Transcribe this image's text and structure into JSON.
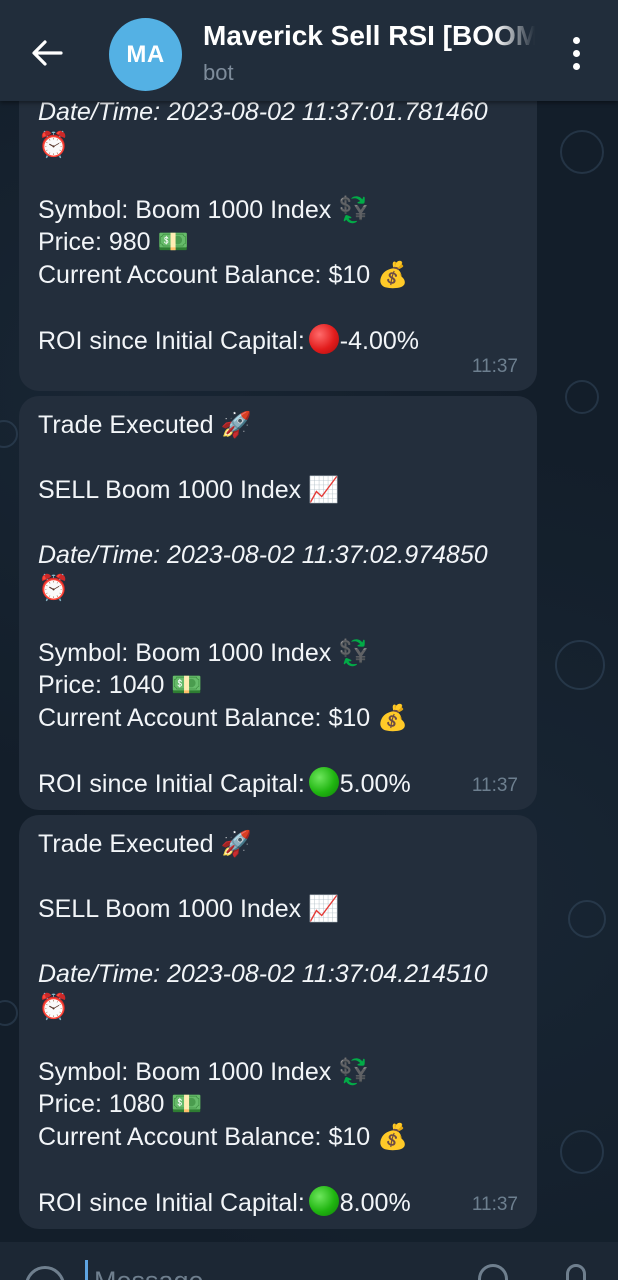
{
  "header": {
    "avatar_initials": "MA",
    "title": "Maverick Sell RSI [BOOM",
    "subtitle": "bot"
  },
  "messages": [
    {
      "datetime": "Date/Time: 2023-08-02 11:37:01.781460",
      "symbol": "Symbol: Boom 1000 Index",
      "price": "Price: 980",
      "balance": "Current Account Balance: $10",
      "roi_label": "ROI since Initial Capital:",
      "roi_status": "red-circle",
      "roi_value": "-4.00%",
      "time": "11:37"
    },
    {
      "trade": "Trade Executed",
      "order": "SELL Boom 1000 Index",
      "datetime": "Date/Time: 2023-08-02 11:37:02.974850",
      "symbol": "Symbol: Boom 1000 Index",
      "price": "Price: 1040",
      "balance": "Current Account Balance: $10",
      "roi_label": "ROI since Initial Capital:",
      "roi_status": "green-circle",
      "roi_value": "5.00%",
      "time": "11:37"
    },
    {
      "trade": "Trade Executed",
      "order": "SELL Boom 1000 Index",
      "datetime": "Date/Time: 2023-08-02 11:37:04.214510",
      "symbol": "Symbol: Boom 1000 Index",
      "price": "Price: 1080",
      "balance": "Current Account Balance: $10",
      "roi_label": "ROI since Initial Capital:",
      "roi_status": "green-circle",
      "roi_value": "8.00%",
      "time": "11:37"
    }
  ],
  "emoji": {
    "rocket": "🚀",
    "chart": "📈",
    "clock": "⏰",
    "exchange": "💱",
    "money": "💵",
    "moneybag": "💰"
  },
  "input": {
    "placeholder": "Message"
  },
  "colors": {
    "header_bg": "#212d3b",
    "bubble_bg": "#232e3c",
    "chat_bg": "#131e2a",
    "avatar": "#54b1e4",
    "time": "#6d7f8f"
  }
}
